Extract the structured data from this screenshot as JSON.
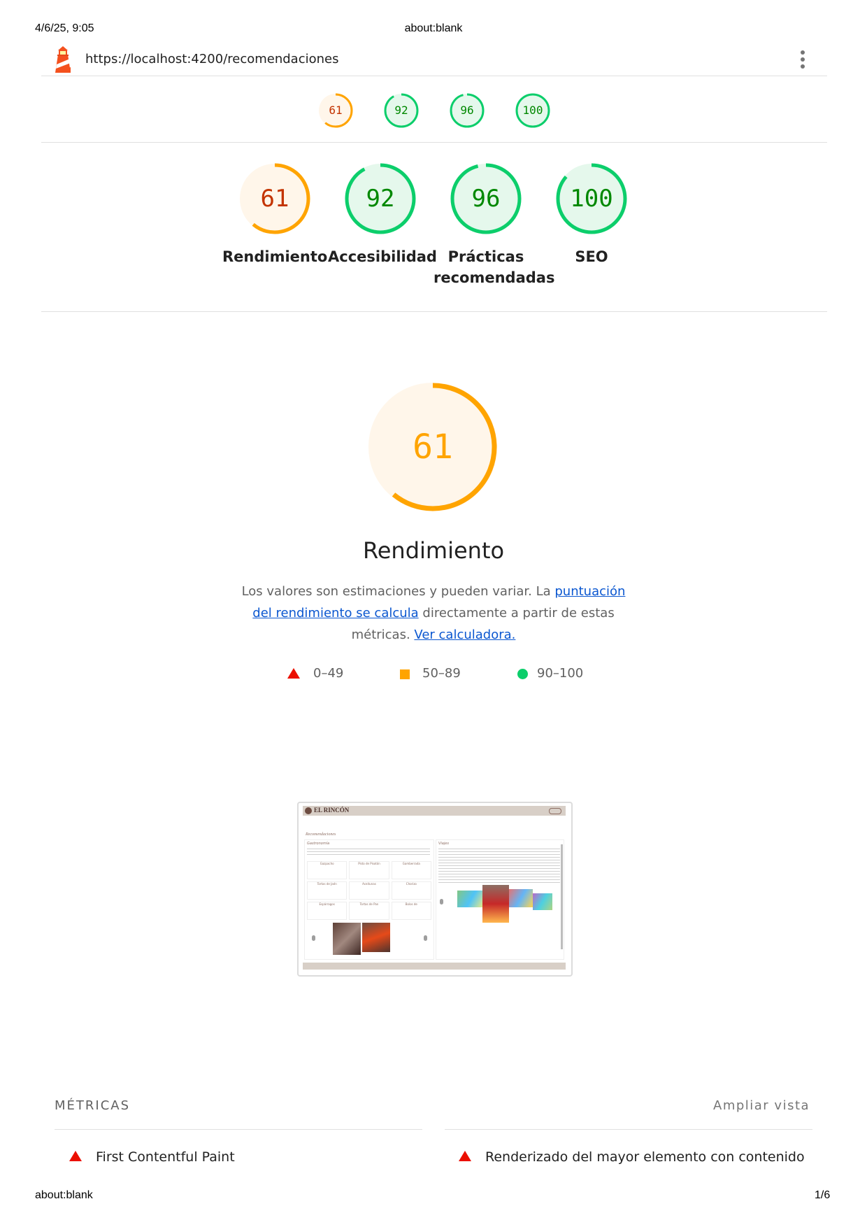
{
  "print_header": {
    "datetime": "4/6/25, 9:05",
    "title": "about:blank"
  },
  "print_footer": {
    "left": "about:blank",
    "page": "1/6"
  },
  "report": {
    "url": "https://localhost:4200/recomendaciones"
  },
  "mini_scores": [
    {
      "value": "61",
      "level": "average"
    },
    {
      "value": "92",
      "level": "pass"
    },
    {
      "value": "96",
      "level": "pass"
    },
    {
      "value": "100",
      "level": "pass"
    }
  ],
  "categories": [
    {
      "score": "61",
      "label": "Rendimiento",
      "level": "average"
    },
    {
      "score": "92",
      "label": "Accesibilidad",
      "level": "pass"
    },
    {
      "score": "96",
      "label": "Prácticas recomendadas",
      "level": "pass"
    },
    {
      "score": "100",
      "label": "SEO",
      "level": "pass"
    }
  ],
  "performance": {
    "score": "61",
    "title": "Rendimiento",
    "desc_prefix": "Los valores son estimaciones y pueden variar. La ",
    "desc_link1": "puntuación del rendimiento se calcula",
    "desc_mid": " directamente a partir de estas métricas. ",
    "desc_link2": "Ver calculadora."
  },
  "legend": [
    {
      "range": "0–49",
      "shape": "triangle",
      "color": "#eb0f00"
    },
    {
      "range": "50–89",
      "shape": "square",
      "color": "#ffa400"
    },
    {
      "range": "90–100",
      "shape": "circle",
      "color": "#0cce6b"
    }
  ],
  "screenshot": {
    "brand": "EL RINCÓN",
    "heading": "Recomendaciones",
    "left_title": "Gastronomía",
    "right_title": "Viajes",
    "dishes": [
      "Gazpacho",
      "Pisto de Pisotón",
      "Gamberrada",
      "Tortas de Jaén",
      "Aceitunas",
      "Chorizo",
      "Espárragos",
      "Tortas de Pan",
      "Bolos de"
    ]
  },
  "metrics": {
    "heading": "MÉTRICAS",
    "toggle": "Ampliar vista",
    "items": [
      "First Contentful Paint",
      "Renderizado del mayor elemento con contenido"
    ]
  },
  "colors": {
    "pass": "#0cce6b",
    "pass_bg": "#e5f8ec",
    "pass_text": "#008800",
    "average": "#ffa400",
    "average_bg": "#fff6ea",
    "average_text": "#c33300",
    "fail": "#eb0f00"
  }
}
